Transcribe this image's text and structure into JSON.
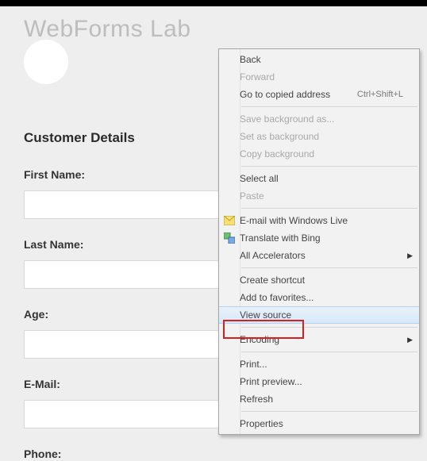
{
  "header": {
    "site_title": "WebForms Lab"
  },
  "page": {
    "title": "Customer Details",
    "fields": {
      "first_name_label": "First Name:",
      "last_name_label": "Last Name:",
      "age_label": "Age:",
      "email_label": "E-Mail:",
      "phone_label": "Phone:"
    }
  },
  "context_menu": {
    "back": "Back",
    "forward": "Forward",
    "goto_copied": "Go to copied address",
    "goto_copied_shortcut": "Ctrl+Shift+L",
    "save_bg": "Save background as...",
    "set_bg": "Set as background",
    "copy_bg": "Copy background",
    "select_all": "Select all",
    "paste": "Paste",
    "email_live": "E-mail with Windows Live",
    "translate_bing": "Translate with Bing",
    "all_accel": "All Accelerators",
    "create_shortcut": "Create shortcut",
    "add_fav": "Add to favorites...",
    "view_source": "View source",
    "encoding": "Encoding",
    "print": "Print...",
    "print_preview": "Print preview...",
    "refresh": "Refresh",
    "properties": "Properties"
  }
}
